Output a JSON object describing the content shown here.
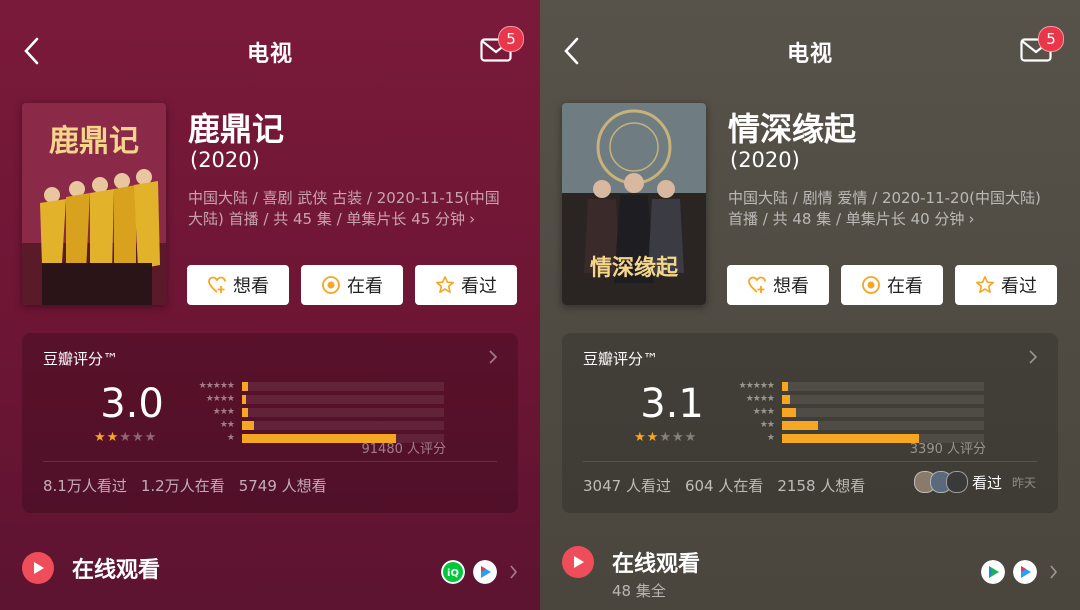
{
  "panels": [
    {
      "header": {
        "title": "电视",
        "mail_badge": "5"
      },
      "movie": {
        "name": "鹿鼎记",
        "year": "(2020)",
        "meta_line1": "中国大陆 / 喜剧 武侠 古装 / 2020-11-15(中国",
        "meta_line2": "大陆) 首播 / 共 45 集 / 单集片长 45 分钟",
        "poster_title": "鹿鼎记"
      },
      "actions": {
        "want": "想看",
        "watching": "在看",
        "watched": "看过"
      },
      "rating": {
        "label": "豆瓣评分™",
        "score": "3.0",
        "stars": 1.5,
        "distribution_pct": [
          3,
          2,
          3,
          6,
          76
        ],
        "count": "91480 人评分",
        "stats": [
          "8.1万人看过",
          "1.2万人在看",
          "5749 人想看"
        ]
      },
      "online": {
        "label": "在线观看",
        "sub": ""
      }
    },
    {
      "header": {
        "title": "电视",
        "mail_badge": "5"
      },
      "movie": {
        "name": "情深缘起",
        "year": "(2020)",
        "meta_line1": "中国大陆 / 剧情 爱情 / 2020-11-20(中国大陆)",
        "meta_line2": "首播 / 共 48 集 / 单集片长 40 分钟",
        "poster_title": "情深缘起"
      },
      "actions": {
        "want": "想看",
        "watching": "在看",
        "watched": "看过"
      },
      "rating": {
        "label": "豆瓣评分™",
        "score": "3.1",
        "stars": 1.5,
        "distribution_pct": [
          3,
          4,
          7,
          18,
          68
        ],
        "count": "3390 人评分",
        "stats": [
          "3047 人看过",
          "604 人在看",
          "2158 人想看"
        ],
        "friends_watched": "看过",
        "friends_time": "昨天"
      },
      "online": {
        "label": "在线观看",
        "sub": "48 集全"
      }
    }
  ],
  "colors": {
    "left_bg": "#6d1534",
    "right_bg": "#4f4b43",
    "accent_star": "#f5a623",
    "play": "#f04d5b",
    "badge": "#e8364a"
  }
}
